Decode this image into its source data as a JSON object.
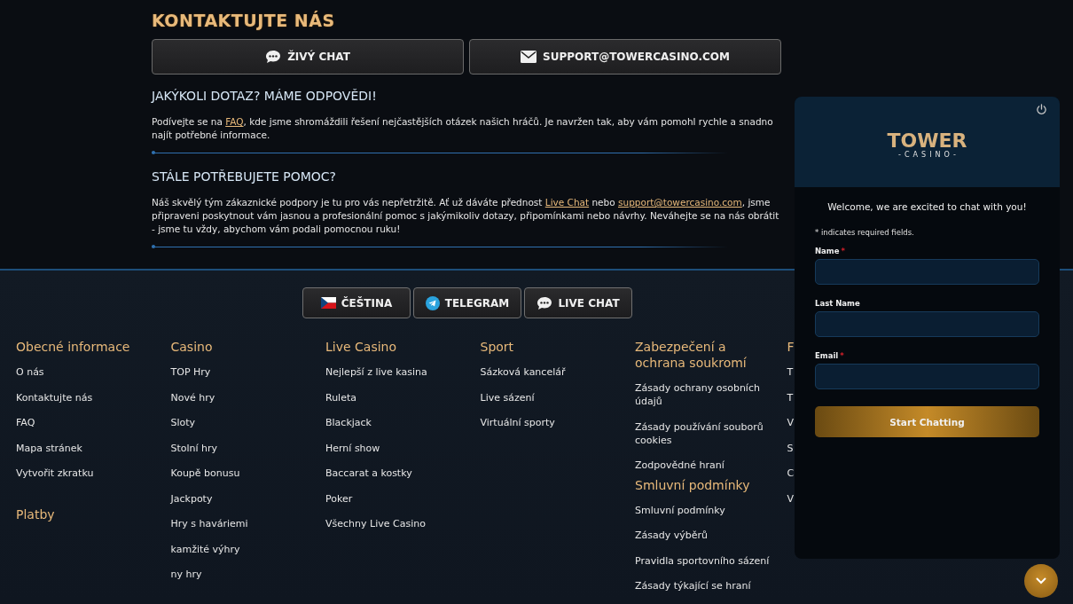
{
  "contact": {
    "title": "KONTAKTUJTE NÁS",
    "buttons": [
      {
        "label": "ŽIVÝ CHAT",
        "kind": "chat"
      },
      {
        "label": "SUPPORT@TOWERCASINO.COM",
        "kind": "mail"
      }
    ]
  },
  "sections": [
    {
      "heading": "JAKÝKOLI DOTAZ? MÁME ODPOVĚDI!",
      "paragraph": [
        {
          "text": "Podívejte se na "
        },
        {
          "text": "FAQ",
          "link": true
        },
        {
          "text": ", kde jsme shromáždili řešení nejčastějších otázek našich hráčů. Je navržen tak, aby vám pomohl rychle a snadno najít potřebné informace."
        }
      ]
    },
    {
      "heading": "STÁLE POTŘEBUJETE POMOC?",
      "paragraph": [
        {
          "text": "Náš skvělý tým zákaznické podpory je tu pro vás nepřetržitě. Ať už dáváte přednost "
        },
        {
          "text": "Live Chat",
          "link": true
        },
        {
          "text": " nebo "
        },
        {
          "text": "support@towercasino.com",
          "link": true
        },
        {
          "text": ", jsme připraveni poskytnout vám jasnou a profesionální pomoc s jakýmikoliv dotazy, připomínkami nebo návrhy. Neváhejte se na nás obrátit - jsme tu vždy, abychom vám podali pomocnou ruku!"
        }
      ]
    }
  ],
  "footer_buttons": [
    {
      "label": "ČEŠTINA",
      "kind": "flag"
    },
    {
      "label": "TELEGRAM",
      "kind": "telegram"
    },
    {
      "label": "LIVE CHAT",
      "kind": "chat"
    }
  ],
  "footer_columns": [
    {
      "groups": [
        {
          "heading": "Obecné informace",
          "links": [
            "O nás",
            "Kontaktujte nás",
            "FAQ",
            "Mapa stránek",
            "Vytvořit zkratku"
          ]
        },
        {
          "heading": "Platby"
        }
      ]
    },
    {
      "groups": [
        {
          "heading": "Casino",
          "links": [
            "TOP Hry",
            "Nové hry",
            "Sloty",
            "Stolní hry",
            "Koupě bonusu",
            "Jackpoty",
            "Hry s haváriemi",
            "kamžité výhry",
            "ny hry"
          ]
        }
      ]
    },
    {
      "groups": [
        {
          "heading": "Live Casino",
          "links": [
            "Nejlepší z live kasina",
            "Ruleta",
            "Blackjack",
            "Herní show",
            "Baccarat a kostky",
            "Poker",
            "Všechny Live Casino"
          ]
        }
      ]
    },
    {
      "groups": [
        {
          "heading": "Sport",
          "links": [
            "Sázková kancelář",
            "Live sázení",
            "Virtuální sporty"
          ]
        }
      ]
    },
    {
      "groups": [
        {
          "heading": "Zabezpečení a ochrana soukromí",
          "links": [
            "Zásady ochrany osobních údajů",
            "Zásady používání souborů cookies",
            "Zodpovědné hraní"
          ]
        },
        {
          "heading": "Smluvní podmínky",
          "links": [
            "Smluvní podmínky",
            "Zásady výběrů",
            "Pravidla sportovního sázení",
            "Zásady týkající se hraní"
          ]
        }
      ]
    },
    {
      "groups": [
        {
          "heading": "F",
          "links": [
            "T",
            "T",
            "V",
            "S",
            "C",
            "V"
          ]
        }
      ]
    }
  ],
  "chat_widget": {
    "logo_title": "TOWER",
    "logo_subtitle": "-CASINO-",
    "welcome": "Welcome, we are excited to chat with you!",
    "required_note": "* indicates required fields.",
    "required_mark": "*",
    "fields": [
      {
        "label": "Name",
        "required": true
      },
      {
        "label": "Last Name",
        "required": false
      },
      {
        "label": "Email",
        "required": true
      }
    ],
    "button": "Start Chatting"
  }
}
